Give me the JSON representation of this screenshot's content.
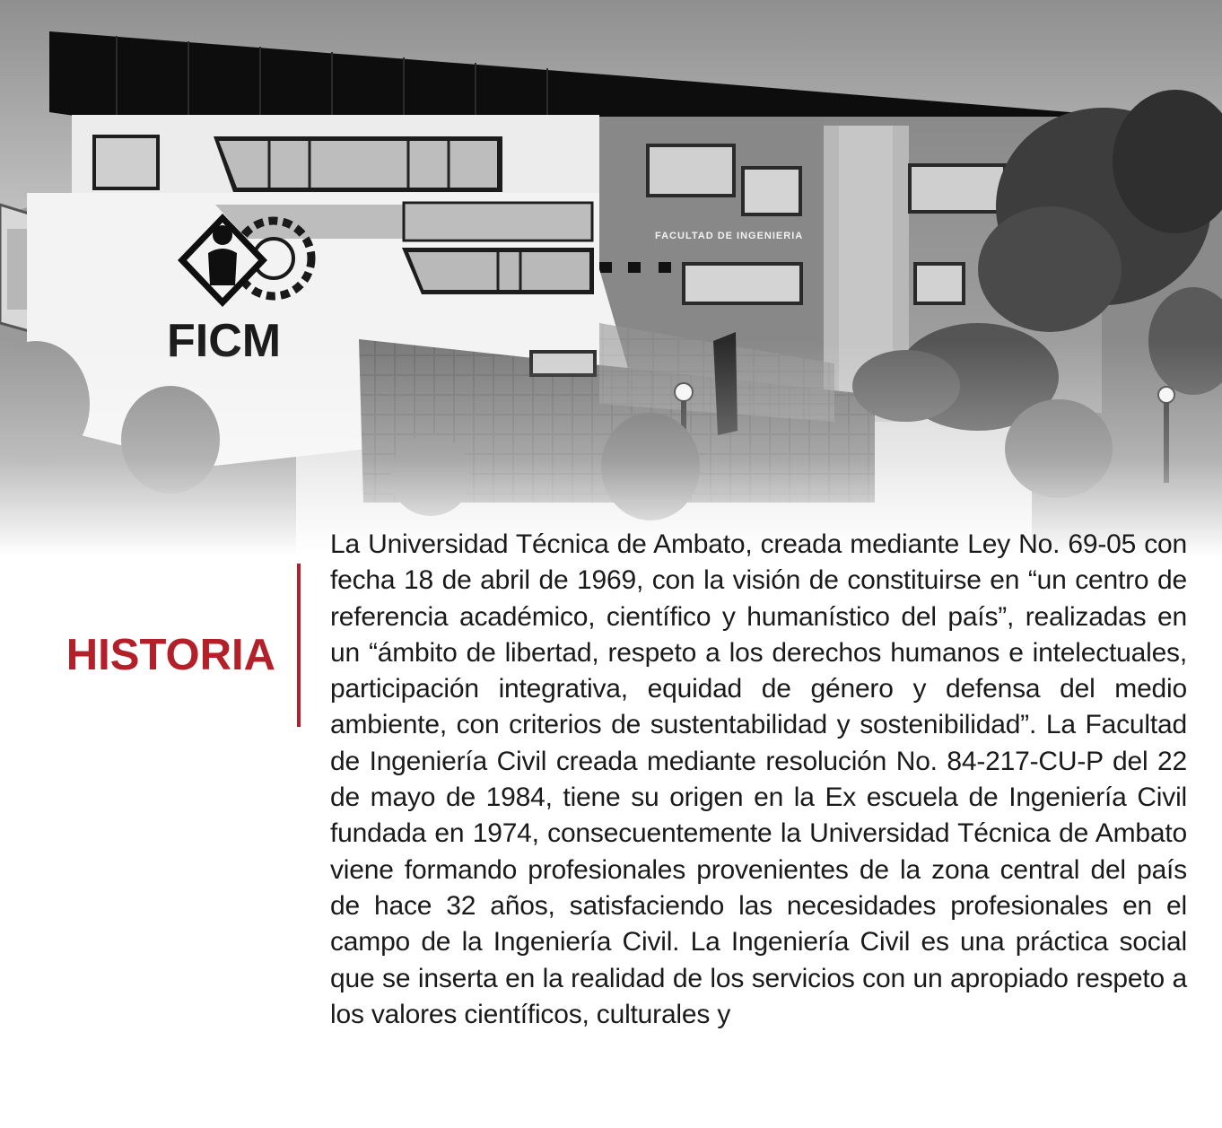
{
  "header_image": {
    "building_sign": "FACULTAD DE INGENIERIA",
    "logo_text": "FICM",
    "logo_icon": "engineer-gear-logo-icon"
  },
  "section": {
    "heading": "HISTORIA",
    "accent_color": "#b3202a",
    "body": "La Universidad Técnica de Ambato, creada mediante Ley No. 69-05 con fecha 18 de abril de 1969, con la visión de constituirse en “un centro de referencia académico, científico y humanístico del país”, realizadas en un “ámbito de libertad, respeto a los derechos humanos e intelectuales, participación integrativa, equidad de género y defensa del medio ambiente, con criterios de sustentabilidad y sostenibilidad”. La Facultad de Ingeniería Civil creada mediante resolución No. 84-217-CU-P del 22 de mayo de 1984, tiene su origen en la Ex escuela de Ingeniería Civil fundada en 1974, consecuentemente la Universidad Técnica de Ambato viene formando profesionales provenientes de la zona central del país de hace 32 años, satisfaciendo las necesidades profesionales en el campo de la Ingeniería Civil. La Ingeniería Civil es una práctica social que se inserta en la realidad de los servicios con un apropiado respeto a los valores científicos, culturales y"
  }
}
